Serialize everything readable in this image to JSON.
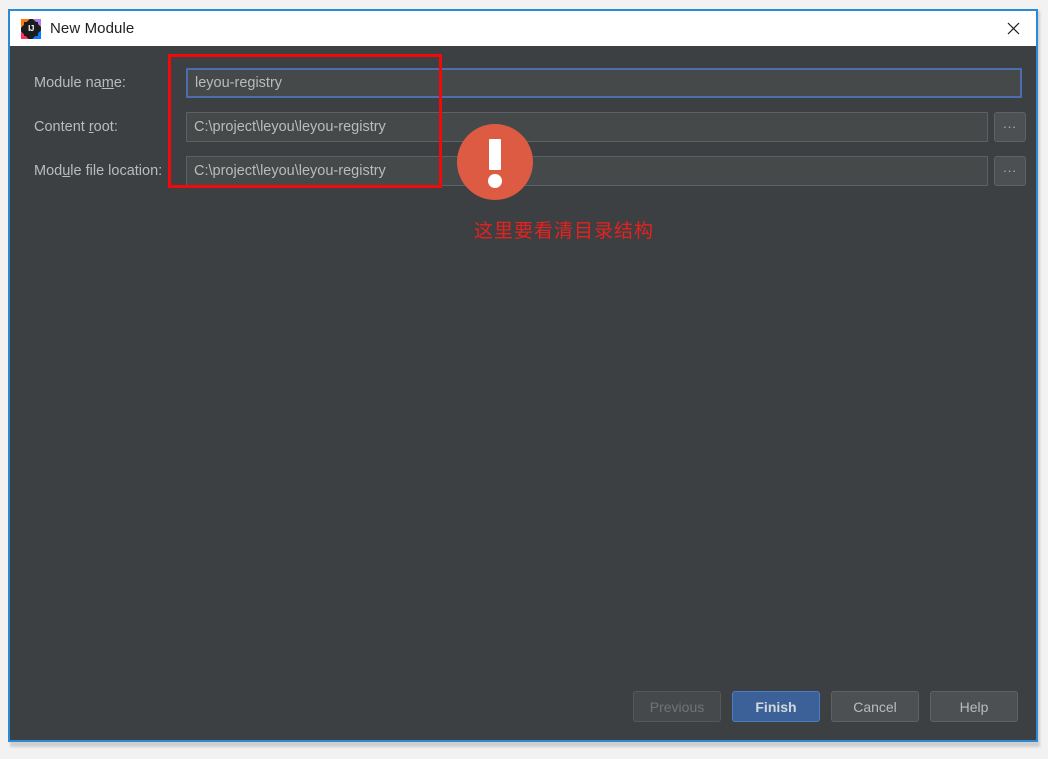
{
  "window": {
    "title": "New Module",
    "icon": "intellij-idea-icon",
    "close_icon": "close-icon",
    "accent_border_color": "#2a8ad4",
    "panel_background": "#3c4042"
  },
  "form": {
    "rows": [
      {
        "label_before": "Module na",
        "label_mnemonic": "m",
        "label_after": "e:",
        "value": "leyou-registry",
        "focused": true,
        "has_browse": false
      },
      {
        "label_before": "Content ",
        "label_mnemonic": "r",
        "label_after": "oot:",
        "value": "C:\\project\\leyou\\leyou-registry",
        "focused": false,
        "has_browse": true,
        "browse_label": "..."
      },
      {
        "label_before": "Mod",
        "label_mnemonic": "u",
        "label_after": "le file location:",
        "value": "C:\\project\\leyou\\leyou-registry",
        "focused": false,
        "has_browse": true,
        "browse_label": "..."
      }
    ]
  },
  "annotation": {
    "highlight_color": "#f20a0a",
    "marker_color": "#dd5b42",
    "text": "这里要看清目录结构",
    "text_color": "#e8201e",
    "icon": "exclamation-circle-icon"
  },
  "footer": {
    "buttons": [
      {
        "label": "Previous",
        "state": "disabled"
      },
      {
        "label": "Finish",
        "state": "default"
      },
      {
        "label": "Cancel",
        "state": "normal"
      },
      {
        "label": "Help",
        "state": "normal"
      }
    ]
  }
}
